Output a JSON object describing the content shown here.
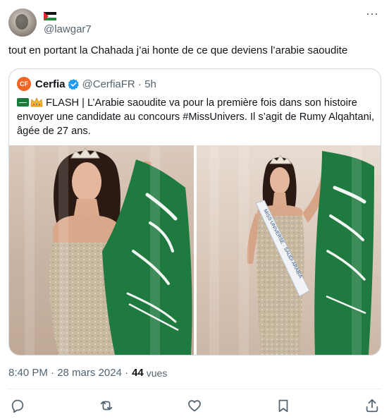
{
  "post": {
    "handle": "@lawgar7",
    "text": "tout en portant la Chahada j’ai honte de ce que deviens l’arabie saoudite",
    "timestamp": "8:40 PM · 28 mars 2024 · ",
    "views_count": "44",
    "views_label": "vues"
  },
  "quoted": {
    "logo_text": "CF",
    "name": "Cerfia",
    "handle_time": "@CerfiaFR · 5h",
    "body": " FLASH | L’Arabie saoudite va pour la première fois dans son histoire envoyer une candidate au concours #MissUnivers. Il s’agit de Rumy Alqahtani, âgée de 27 ans.",
    "sash_text": "MISS UNIVERSE · SAUDI ARABIA"
  },
  "colors": {
    "text_primary": "#0f1419",
    "text_secondary": "#536471",
    "border": "#cfd9de",
    "verified_blue": "#1d9bf0",
    "saudi_green": "#1a7a3a"
  },
  "icons": [
    "more-options-icon",
    "verified-badge-icon",
    "reply-icon",
    "repost-icon",
    "like-icon",
    "bookmark-icon",
    "share-icon"
  ]
}
